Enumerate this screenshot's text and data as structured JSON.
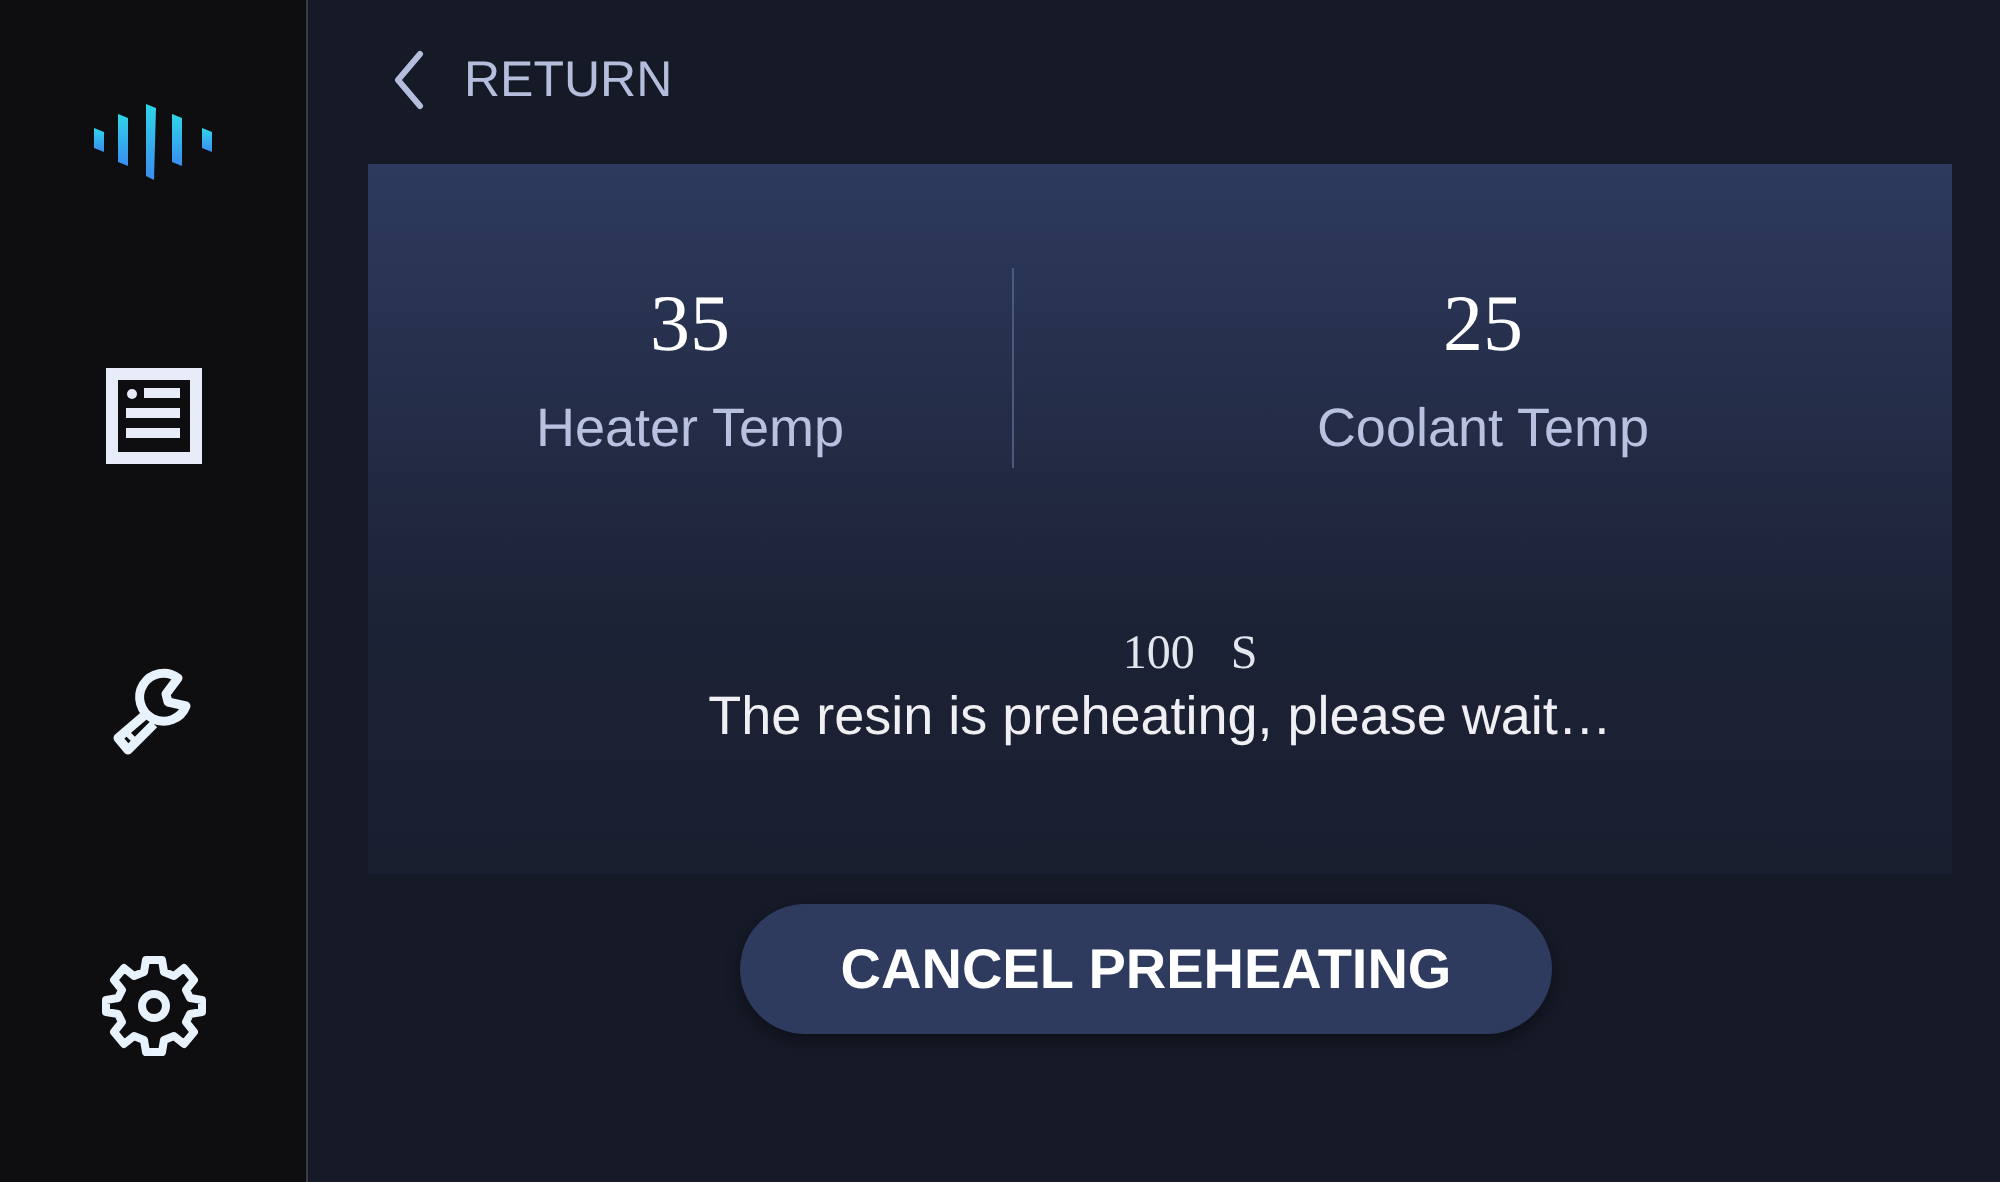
{
  "back": {
    "label": "RETURN"
  },
  "temps": [
    {
      "value": "35",
      "label": "Heater Temp"
    },
    {
      "value": "25",
      "label": "Coolant Temp"
    }
  ],
  "countdown": "100 S",
  "message": "The resin is preheating, please wait…",
  "button": "CANCEL PREHEATING"
}
